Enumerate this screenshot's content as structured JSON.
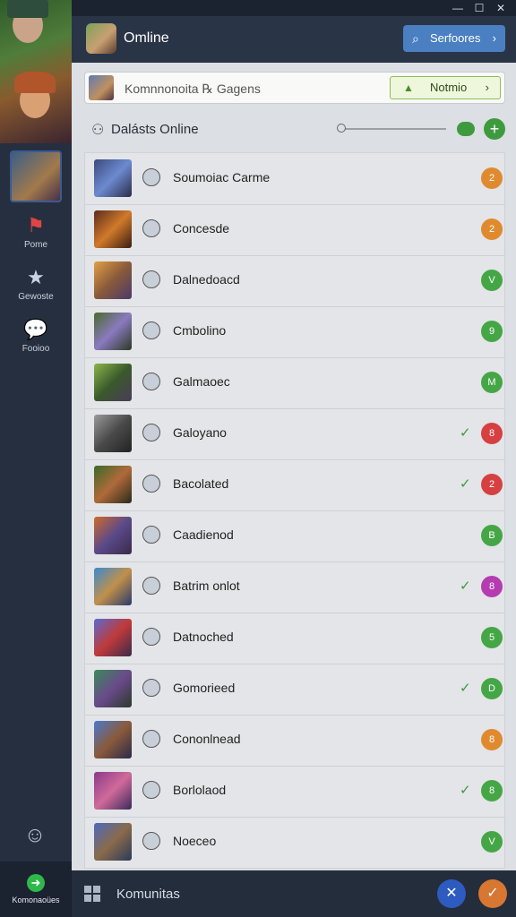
{
  "header": {
    "title": "Omline",
    "action_label": "Serfoores",
    "action_icon": "search-icon"
  },
  "search": {
    "text": "Komnnonoita ℞ Gagens",
    "button_label": "Notmio"
  },
  "section": {
    "title": "Dalásts Online"
  },
  "sidebar": {
    "items": [
      {
        "label": "Pome",
        "icon": "flag-icon"
      },
      {
        "label": "Gewoste",
        "icon": "star-icon"
      },
      {
        "label": "Fooioo",
        "icon": "chat-icon"
      }
    ],
    "active_label": "Komonaoües"
  },
  "bottombar": {
    "label": "Komunitas"
  },
  "rows": [
    {
      "name": "Soumoiac Carme",
      "check": "",
      "badge": "2",
      "badge_color": "#e08a2f"
    },
    {
      "name": "Concesde",
      "check": "",
      "badge": "2",
      "badge_color": "#e08a2f"
    },
    {
      "name": "Dalnedoacd",
      "check": "",
      "badge": "V",
      "badge_color": "#45a646"
    },
    {
      "name": "Cmbolino",
      "check": "",
      "badge": "9",
      "badge_color": "#45a646"
    },
    {
      "name": "Galmaoec",
      "check": "",
      "badge": "M",
      "badge_color": "#45a646"
    },
    {
      "name": "Galoyano",
      "check": "✓",
      "badge": "8",
      "badge_color": "#d64040"
    },
    {
      "name": "Bacolated",
      "check": "✓",
      "badge": "2",
      "badge_color": "#d64040"
    },
    {
      "name": "Caadienod",
      "check": "",
      "badge": "B",
      "badge_color": "#45a646"
    },
    {
      "name": "Batrim onlot",
      "check": "✓",
      "badge": "8",
      "badge_color": "#b53bb0"
    },
    {
      "name": "Datnoched",
      "check": "",
      "badge": "5",
      "badge_color": "#45a646"
    },
    {
      "name": "Gomorieed",
      "check": "✓",
      "badge": "D",
      "badge_color": "#45a646"
    },
    {
      "name": "Cononlnead",
      "check": "",
      "badge": "8",
      "badge_color": "#e08a2f"
    },
    {
      "name": "Borlolaod",
      "check": "✓",
      "badge": "8",
      "badge_color": "#45a646"
    },
    {
      "name": "Noeceo",
      "check": "",
      "badge": "V",
      "badge_color": "#45a646"
    }
  ]
}
